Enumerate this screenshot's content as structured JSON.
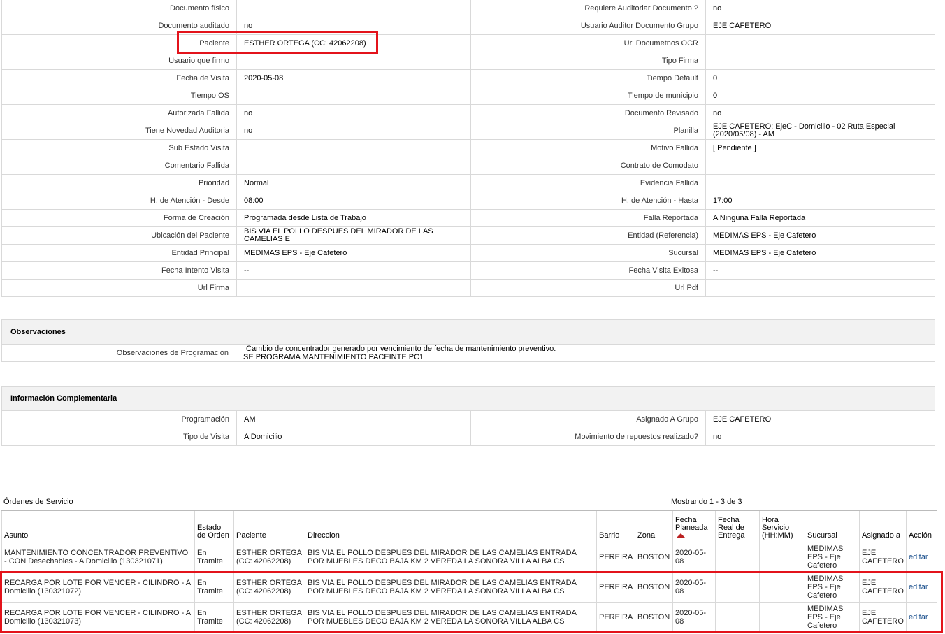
{
  "detail_rows": [
    {
      "l1": "Documento físico",
      "v1": "",
      "l2": "Requiere Auditoriar Documento ?",
      "v2": "no"
    },
    {
      "l1": "Documento auditado",
      "v1": "no",
      "l2": "Usuario Auditor Documento Grupo",
      "v2": "EJE CAFETERO"
    },
    {
      "l1": "Paciente",
      "v1": "ESTHER ORTEGA (CC: 42062208)",
      "l2": "Url Documetnos OCR",
      "v2": ""
    },
    {
      "l1": "Usuario que firmo",
      "v1": "",
      "l2": "Tipo Firma",
      "v2": ""
    },
    {
      "l1": "Fecha de Visita",
      "v1": "2020-05-08",
      "l2": "Tiempo Default",
      "v2": "0"
    },
    {
      "l1": "Tiempo OS",
      "v1": "",
      "l2": "Tiempo de municipio",
      "v2": "0"
    },
    {
      "l1": "Autorizada Fallida",
      "v1": "no",
      "l2": "Documento Revisado",
      "v2": "no"
    },
    {
      "l1": "Tiene Novedad Auditoria",
      "v1": "no",
      "l2": "Planilla",
      "v2": "EJE CAFETERO: EjeC - Domicilio - 02 Ruta Especial (2020/05/08) - AM"
    },
    {
      "l1": "Sub Estado Visita",
      "v1": "",
      "l2": "Motivo Fallida",
      "v2": "[ Pendiente ]"
    },
    {
      "l1": "Comentario Fallida",
      "v1": "",
      "l2": "Contrato de Comodato",
      "v2": ""
    },
    {
      "l1": "Prioridad",
      "v1": "Normal",
      "l2": "Evidencia Fallida",
      "v2": ""
    },
    {
      "l1": "H. de Atención - Desde",
      "v1": "08:00",
      "l2": "H. de Atención - Hasta",
      "v2": "17:00"
    },
    {
      "l1": "Forma de Creación",
      "v1": "Programada desde Lista de Trabajo",
      "l2": "Falla Reportada",
      "v2": "A Ninguna Falla Reportada"
    },
    {
      "l1": "Ubicación del Paciente",
      "v1": "BIS VIA EL POLLO DESPUES DEL MIRADOR DE LAS CAMELIAS E",
      "l2": "Entidad (Referencia)",
      "v2": "MEDIMAS EPS - Eje Cafetero"
    },
    {
      "l1": "Entidad Principal",
      "v1": "MEDIMAS EPS - Eje Cafetero",
      "l2": "Sucursal",
      "v2": "MEDIMAS EPS - Eje Cafetero"
    },
    {
      "l1": "Fecha Intento Visita",
      "v1": "--",
      "l2": "Fecha Visita Exitosa",
      "v2": "--"
    },
    {
      "l1": "Url Firma",
      "v1": "",
      "l2": "Url Pdf",
      "v2": ""
    }
  ],
  "observaciones": {
    "title": "Observaciones",
    "label": "Observaciones de Programación",
    "line1": "Cambio de concentrador generado por vencimiento de fecha de mantenimiento preventivo.",
    "line2": "SE PROGRAMA MANTENIMIENTO PACEINTE PC1"
  },
  "complementaria": {
    "title": "Información Complementaria",
    "rows": [
      {
        "l1": "Programación",
        "v1": "AM",
        "l2": "Asignado A Grupo",
        "v2": "EJE CAFETERO"
      },
      {
        "l1": "Tipo de Visita",
        "v1": "A Domicilio",
        "l2": "Movimiento de repuestos realizado?",
        "v2": "no"
      }
    ]
  },
  "orders": {
    "title": "Órdenes de Servicio",
    "showing": "Mostrando 1 - 3 de 3",
    "headers": [
      "Asunto",
      "Estado de Orden",
      "Paciente",
      "Direccion",
      "Barrio",
      "Zona",
      "Fecha Planeada",
      "Fecha Real de Entrega",
      "Hora Servicio (HH:MM)",
      "Sucursal",
      "Asignado a",
      "Acción"
    ],
    "rows": [
      {
        "asunto": "MANTENIMIENTO CONCENTRADOR PREVENTIVO - CON Desechables - A Domicilio (130321071)",
        "estado": "En Tramite",
        "paciente": "ESTHER ORTEGA (CC: 42062208)",
        "direccion": "BIS VIA EL POLLO DESPUES DEL MIRADOR DE LAS CAMELIAS ENTRADA POR MUEBLES DECO BAJA KM 2 VEREDA LA SONORA VILLA ALBA CS",
        "barrio": "PEREIRA",
        "zona": "BOSTON",
        "fecha": "2020-05-08",
        "real": "",
        "hora": "",
        "sucursal": "MEDIMAS EPS - Eje Cafetero",
        "asignado": "EJE CAFETERO",
        "accion": "editar"
      },
      {
        "asunto": "RECARGA POR LOTE POR VENCER - CILINDRO - A Domicilio (130321072)",
        "estado": "En Tramite",
        "paciente": "ESTHER ORTEGA (CC: 42062208)",
        "direccion": "BIS VIA EL POLLO DESPUES DEL MIRADOR DE LAS CAMELIAS ENTRADA POR MUEBLES DECO BAJA KM 2 VEREDA LA SONORA VILLA ALBA CS",
        "barrio": "PEREIRA",
        "zona": "BOSTON",
        "fecha": "2020-05-08",
        "real": "",
        "hora": "",
        "sucursal": "MEDIMAS EPS - Eje Cafetero",
        "asignado": "EJE CAFETERO",
        "accion": "editar"
      },
      {
        "asunto": "RECARGA POR LOTE POR VENCER - CILINDRO - A Domicilio (130321073)",
        "estado": "En Tramite",
        "paciente": "ESTHER ORTEGA (CC: 42062208)",
        "direccion": "BIS VIA EL POLLO DESPUES DEL MIRADOR DE LAS CAMELIAS ENTRADA POR MUEBLES DECO BAJA KM 2 VEREDA LA SONORA VILLA ALBA CS",
        "barrio": "PEREIRA",
        "zona": "BOSTON",
        "fecha": "2020-05-08",
        "real": "",
        "hora": "",
        "sucursal": "MEDIMAS EPS - Eje Cafetero",
        "asignado": "EJE CAFETERO",
        "accion": "editar"
      }
    ]
  },
  "highlight_color": "#e3131b",
  "sort_icon": "sort-up-arrow-icon"
}
